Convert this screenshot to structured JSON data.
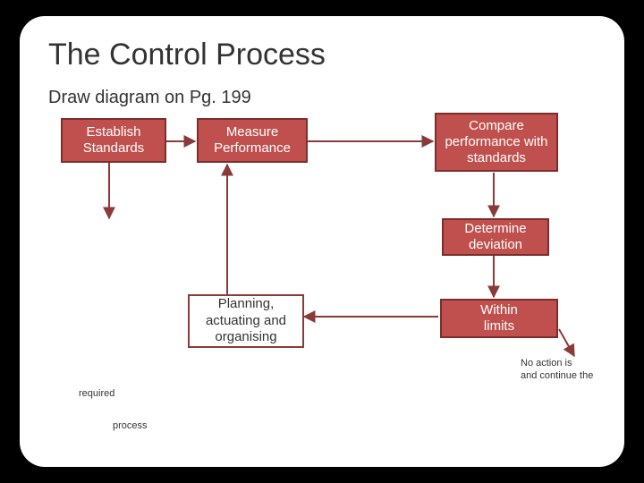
{
  "title": "The Control Process",
  "subtitle": "Draw diagram on Pg. 199",
  "boxes": {
    "establish": "Establish\nStandards",
    "measure": "Measure\nPerformance",
    "compare": "Compare performance with standards",
    "determine": "Determine deviation",
    "planning": "Planning, actuating and organising",
    "within": "Within\nlimits"
  },
  "notes": {
    "noaction": "No action is\nand continue the",
    "required": "required",
    "process": "process"
  },
  "colors": {
    "boxFill": "#c0504d",
    "boxBorder": "#7a2f2d",
    "arrow": "#8a3b39"
  }
}
